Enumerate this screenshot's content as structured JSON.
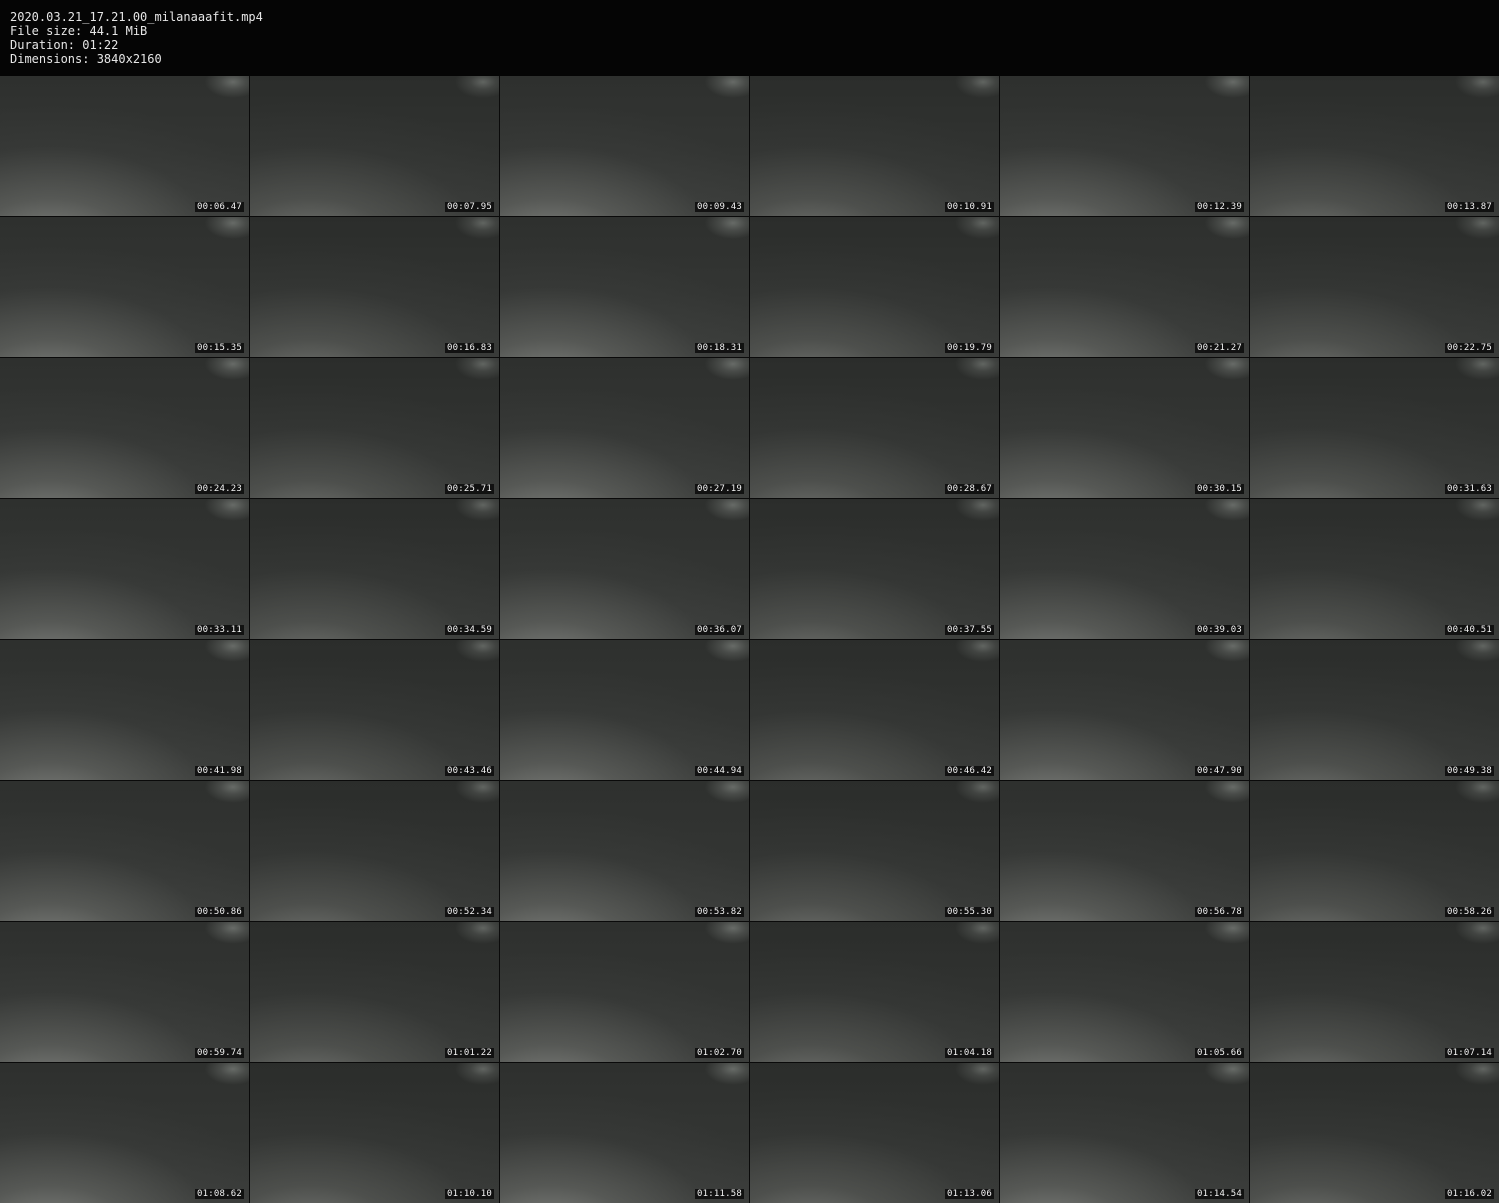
{
  "header": {
    "filename": "2020.03.21_17.21.00_milanaaafit.mp4",
    "file_size": "File size: 44.1 MiB",
    "duration": "Duration: 01:22",
    "dimensions": "Dimensions: 3840x2160"
  },
  "thumbnails": [
    "00:06.47",
    "00:07.95",
    "00:09.43",
    "00:10.91",
    "00:12.39",
    "00:13.87",
    "00:15.35",
    "00:16.83",
    "00:18.31",
    "00:19.79",
    "00:21.27",
    "00:22.75",
    "00:24.23",
    "00:25.71",
    "00:27.19",
    "00:28.67",
    "00:30.15",
    "00:31.63",
    "00:33.11",
    "00:34.59",
    "00:36.07",
    "00:37.55",
    "00:39.03",
    "00:40.51",
    "00:41.98",
    "00:43.46",
    "00:44.94",
    "00:46.42",
    "00:47.90",
    "00:49.38",
    "00:50.86",
    "00:52.34",
    "00:53.82",
    "00:55.30",
    "00:56.78",
    "00:58.26",
    "00:59.74",
    "01:01.22",
    "01:02.70",
    "01:04.18",
    "01:05.66",
    "01:07.14",
    "01:08.62",
    "01:10.10",
    "01:11.58",
    "01:13.06",
    "01:14.54",
    "01:16.02"
  ]
}
